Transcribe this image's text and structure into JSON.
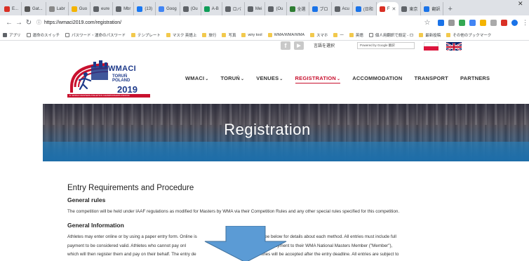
{
  "browser": {
    "tabs": [
      {
        "label": "E...",
        "color": "#d93025"
      },
      {
        "label": "Gat...",
        "color": "#555555"
      },
      {
        "label": "Labr",
        "color": "#888888"
      },
      {
        "label": "Guo",
        "color": "#f4b400"
      },
      {
        "label": "eure",
        "color": "#5f6368"
      },
      {
        "label": "Mbr",
        "color": "#5f6368"
      },
      {
        "label": "(13)",
        "color": "#1877f2"
      },
      {
        "label": "Goog",
        "color": "#4285f4"
      },
      {
        "label": "(Ou",
        "color": "#5f6368"
      },
      {
        "label": "A-B",
        "color": "#0f9d58"
      },
      {
        "label": "ロバ",
        "color": "#5f6368"
      },
      {
        "label": "Mei",
        "color": "#5f6368"
      },
      {
        "label": "(Ou",
        "color": "#5f6368"
      },
      {
        "label": "全選",
        "color": "#2e7d32"
      },
      {
        "label": "ブロ",
        "color": "#1a73e8"
      },
      {
        "label": "Acu",
        "color": "#5f6368"
      },
      {
        "label": "(日和",
        "color": "#1a73e8"
      },
      {
        "label": "F",
        "color": "#d93025",
        "active": true
      },
      {
        "label": "東京",
        "color": "#5f6368"
      },
      {
        "label": "翻訳",
        "color": "#1a73e8"
      }
    ],
    "new_tab": "+",
    "url": "https://wmaci2019.com/registration/",
    "bookmarks": [
      {
        "label": "アプリ",
        "type": "apps"
      },
      {
        "label": "運命のスイッチ",
        "type": "doc"
      },
      {
        "label": "パスワード・運命のパスワード",
        "type": "doc"
      },
      {
        "label": "テンプレート",
        "type": "folder"
      },
      {
        "label": "マスク 英語上",
        "type": "folder"
      },
      {
        "label": "旅行",
        "type": "folder"
      },
      {
        "label": "写真",
        "type": "folder"
      },
      {
        "label": "wiry tool",
        "type": "folder"
      },
      {
        "label": "WMA/WMA/WMA",
        "type": "folder"
      },
      {
        "label": "スマホ",
        "type": "folder"
      },
      {
        "label": "一",
        "type": "folder"
      },
      {
        "label": "英語",
        "type": "folder"
      },
      {
        "label": "個人用翻訳で設定 - ロ",
        "type": "doc"
      },
      {
        "label": "最新投稿",
        "type": "folder"
      },
      {
        "label": "その他のブックマーク",
        "type": "folder"
      }
    ]
  },
  "site": {
    "top": {
      "facebook_glyph": "f",
      "youtube_glyph": "▶",
      "language_label": "言語を選択",
      "translate_label": "Powered by Google 翻訳"
    },
    "logo": {
      "title": "WMACI",
      "city_line1": "TORUŃ",
      "city_line2": "POLAND",
      "year": "2019",
      "strip": "8. WORLD MASTERS ATHLETICS CHAMPIONSHIPS INDOOR"
    },
    "nav": [
      {
        "label": "WMACI",
        "dropdown": true,
        "active": false
      },
      {
        "label": "TORUŃ",
        "dropdown": true,
        "active": false
      },
      {
        "label": "VENUES",
        "dropdown": true,
        "active": false
      },
      {
        "label": "REGISTRATION",
        "dropdown": true,
        "active": true
      },
      {
        "label": "ACCOMMODATION",
        "dropdown": false,
        "active": false
      },
      {
        "label": "TRANSPORT",
        "dropdown": false,
        "active": false
      },
      {
        "label": "PARTNERS",
        "dropdown": false,
        "active": false
      }
    ],
    "hero_title": "Registration",
    "content": {
      "heading": "Entry Requirements and Procedure",
      "general_rules_heading": "General rules",
      "general_rules_text": "The competition will be held under IAAF regulations as modified for Masters by WMA via their Competition Rules and any other special rules specified for this competition.",
      "general_info_heading": "General Information",
      "general_info_lines": [
        "Athletes may enter online or by using a paper entry form. Online is                          method of entry. See below for details about each method. All entries must include full",
        "payment to be considered valid. Athletes who cannot pay onl                                    paper entry form and payment to their WMA National Masters Member (\"Member\"),",
        "which will then register them and pay on their behalf. The entry de                            ary 2019. No entries will be accepted after the entry deadline. All entries are subject to"
      ]
    },
    "colors": {
      "brand_blue": "#1e3a8a",
      "brand_red": "#c8102e",
      "overlay_arrow": "#5b9bd5"
    }
  }
}
